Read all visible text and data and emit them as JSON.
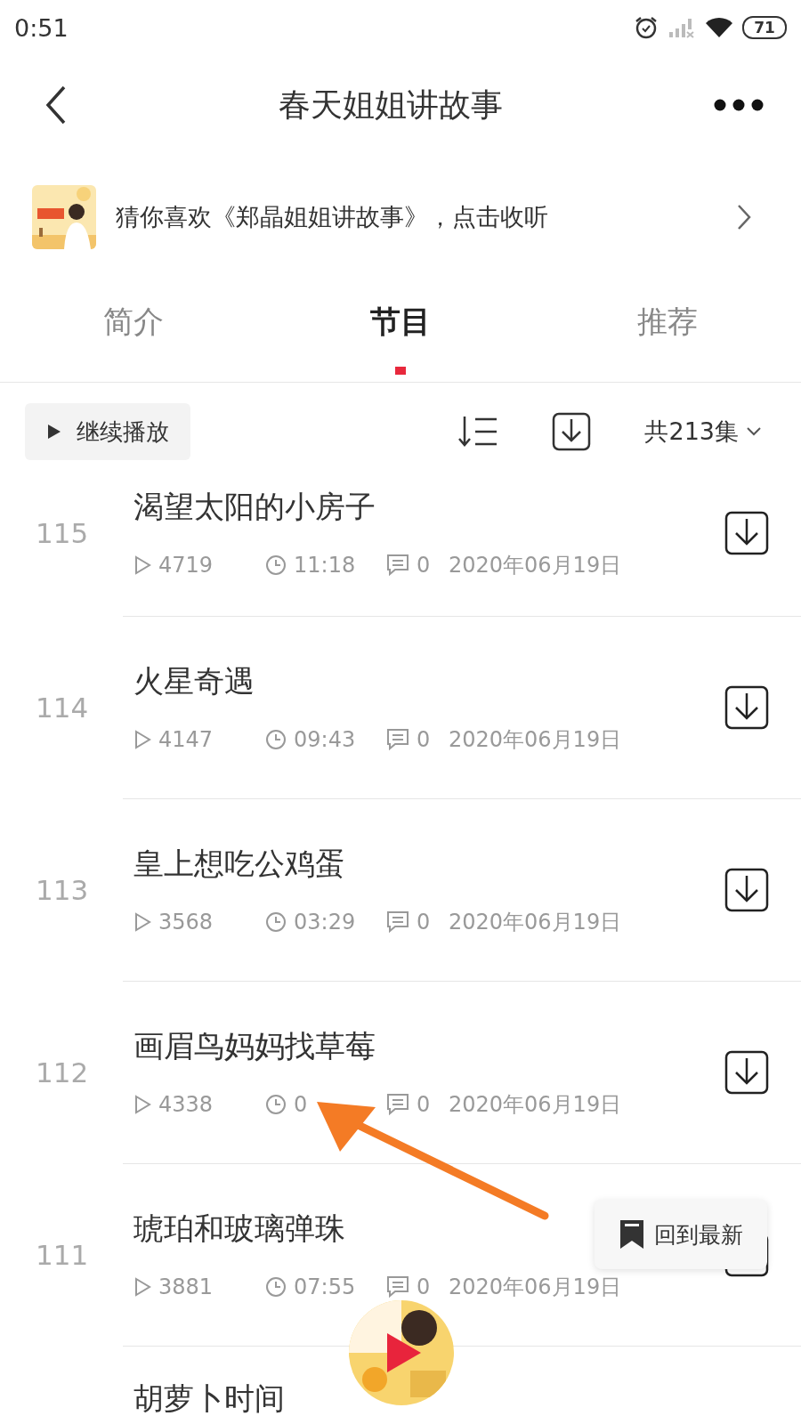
{
  "status_bar": {
    "time": "0:51",
    "battery": "71"
  },
  "header": {
    "title": "春天姐姐讲故事"
  },
  "banner": {
    "text": "猜你喜欢《郑晶姐姐讲故事》，点击收听"
  },
  "tabs": [
    {
      "label": "简介",
      "selected": false
    },
    {
      "label": "节目",
      "selected": true
    },
    {
      "label": "推荐",
      "selected": false
    }
  ],
  "toolbar": {
    "continue_label": "继续播放",
    "count": "共213集"
  },
  "episodes": [
    {
      "number": "115",
      "title": "渴望太阳的小房子",
      "plays": "4719",
      "duration": "11:18",
      "comments": "0",
      "date": "2020年06月19日"
    },
    {
      "number": "114",
      "title": "火星奇遇",
      "plays": "4147",
      "duration": "09:43",
      "comments": "0",
      "date": "2020年06月19日"
    },
    {
      "number": "113",
      "title": "皇上想吃公鸡蛋",
      "plays": "3568",
      "duration": "03:29",
      "comments": "0",
      "date": "2020年06月19日"
    },
    {
      "number": "112",
      "title": "画眉鸟妈妈找草莓",
      "plays": "4338",
      "duration": "0",
      "comments": "0",
      "date": "2020年06月19日"
    },
    {
      "number": "111",
      "title": "琥珀和玻璃弹珠",
      "plays": "3881",
      "duration": "07:55",
      "comments": "0",
      "date": "2020年06月19日"
    },
    {
      "title": "胡萝卜时间"
    }
  ],
  "back_to_latest": {
    "label": "回到最新"
  }
}
